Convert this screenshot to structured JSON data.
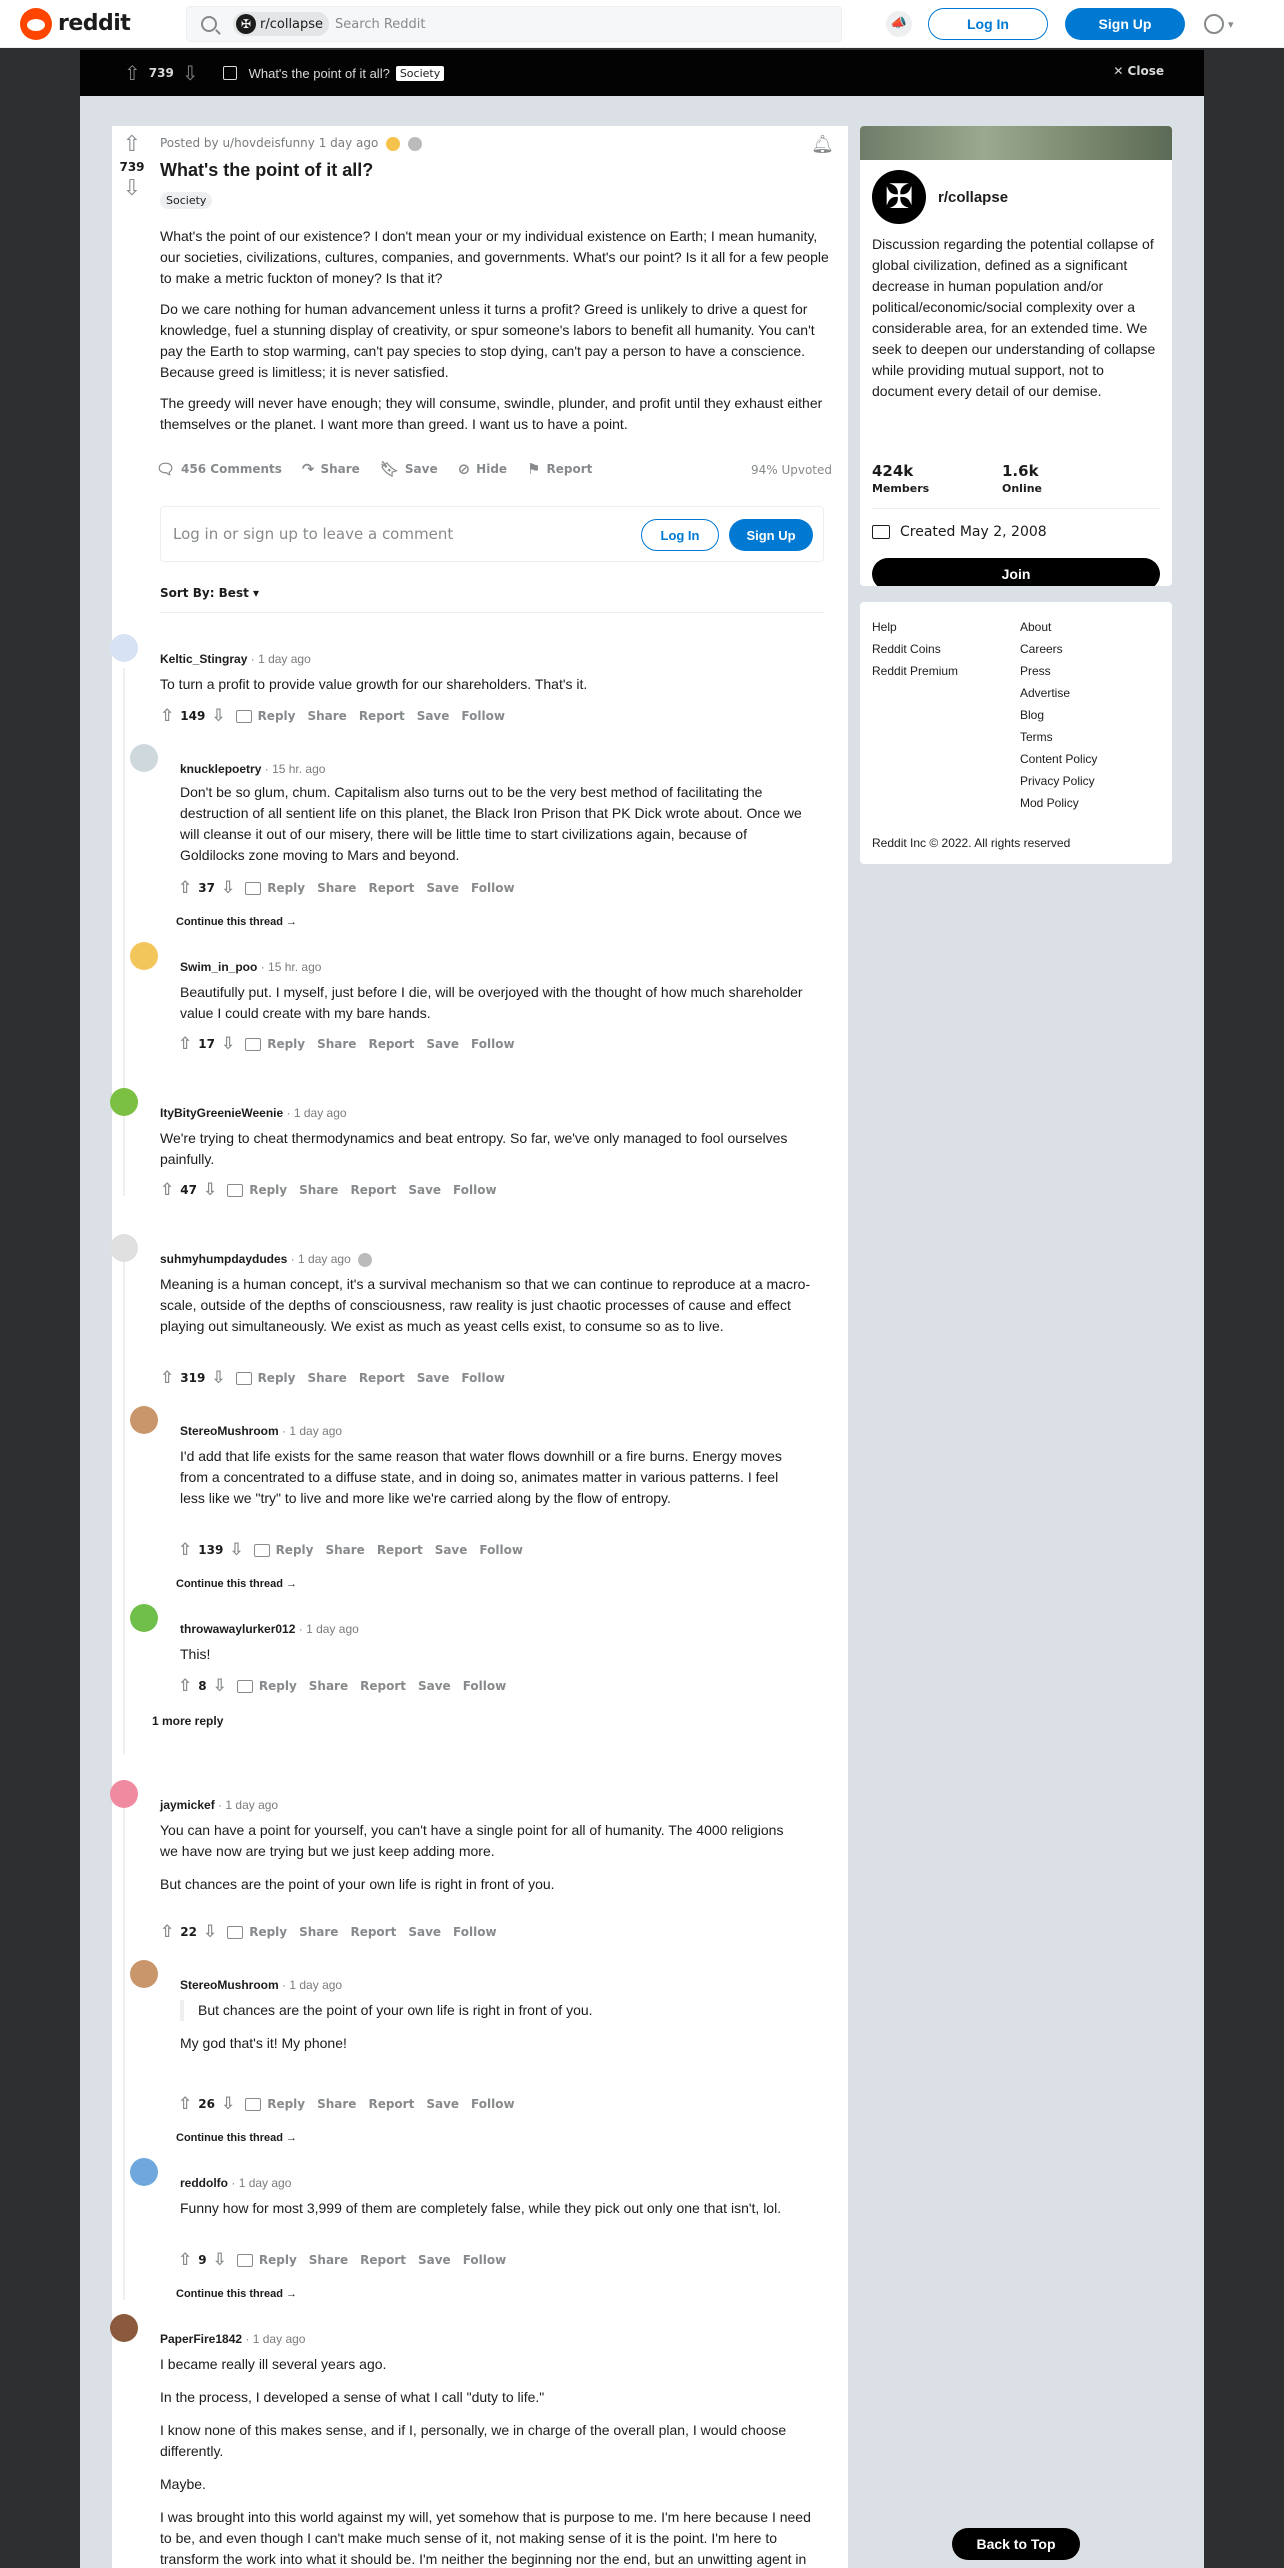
{
  "header": {
    "logo_text": "reddit",
    "subreddit_chip": "r/collapse",
    "search_placeholder": "Search Reddit",
    "login": "Log In",
    "signup": "Sign Up"
  },
  "postbar": {
    "score": "739",
    "title": "What's the point of it all?",
    "flair": "Society",
    "close": "Close"
  },
  "post": {
    "meta": "Posted by u/hovdeisfunny 1 day ago",
    "score": "739",
    "title": "What's the point of it all?",
    "flair": "Society",
    "paragraphs": [
      "What's the point of our existence? I don't mean your or my individual existence on Earth; I mean humanity, our societies, civilizations, cultures, companies, and governments. What's our point? Is it all for a few people to make a metric fuckton of money? Is that it?",
      "Do we care nothing for human advancement unless it turns a profit? Greed is unlikely to drive a quest for knowledge, fuel a stunning display of creativity, or spur someone's labors to benefit all humanity. You can't pay the Earth to stop warming, can't pay species to stop dying, can't pay a person to have a conscience. Because greed is limitless; it is never satisfied.",
      "The greedy will never have enough; they will consume, swindle, plunder, and profit until they exhaust either themselves or the planet. I want more than greed. I want us to have a point."
    ],
    "actions": {
      "comments": "456 Comments",
      "share": "Share",
      "save": "Save",
      "hide": "Hide",
      "report": "Report",
      "upvoted": "94% Upvoted"
    },
    "login_prompt": "Log in or sign up to leave a comment",
    "login_btn": "Log In",
    "signup_btn": "Sign Up",
    "sort": "Sort By: Best"
  },
  "comment_actions": {
    "reply": "Reply",
    "share": "Share",
    "report": "Report",
    "save": "Save",
    "follow": "Follow",
    "continue": "Continue this thread",
    "more_reply": "1 more reply"
  },
  "comments": [
    {
      "user": "Keltic_Stingray",
      "time": "1 day ago",
      "text": "To turn a profit to provide value growth for our shareholders. That's it.",
      "score": "149"
    },
    {
      "user": "knucklepoetry",
      "time": "15 hr. ago",
      "text": "Don't be so glum, chum. Capitalism also turns out to be the very best method of facilitating the destruction of all sentient life on this planet, the Black Iron Prison that PK Dick wrote about. Once we will cleanse it out of our misery, there will be little time to start civilizations again, because of Goldilocks zone moving to Mars and beyond.",
      "score": "37"
    },
    {
      "user": "Swim_in_poo",
      "time": "15 hr. ago",
      "text": "Beautifully put. I myself, just before I die, will be overjoyed with the thought of how much shareholder value I could create with my bare hands.",
      "score": "17"
    },
    {
      "user": "ItyBityGreenieWeenie",
      "time": "1 day ago",
      "text": "We're trying to cheat thermodynamics and beat entropy. So far, we've only managed to fool ourselves painfully.",
      "score": "47"
    },
    {
      "user": "suhmyhumpdaydudes",
      "time": "1 day ago",
      "text": "Meaning is a human concept, it's a survival mechanism so that we can continue to reproduce at a macro-scale, outside of the depths of consciousness, raw reality is just chaotic processes of cause and effect playing out simultaneously. We exist as much as yeast cells exist, to consume so as to live.",
      "score": "319"
    },
    {
      "user": "StereoMushroom",
      "time": "1 day ago",
      "text": "I'd add that life exists for the same reason that water flows downhill or a fire burns. Energy moves from a concentrated to a diffuse state, and in doing so, animates matter in various patterns. I feel less like we \"try\" to live and more like we're carried along by the flow of entropy.",
      "score": "139"
    },
    {
      "user": "throwawaylurker012",
      "time": "1 day ago",
      "text": "This!",
      "score": "8"
    },
    {
      "user": "jaymickef",
      "time": "1 day ago",
      "text": "You can have a point for yourself, you can't have a single point for all of humanity. The 4000 religions we have now are trying but we just keep adding more.",
      "text2": "But chances are the point of your own life is right in front of you.",
      "score": "22"
    },
    {
      "user": "StereoMushroom",
      "time": "1 day ago",
      "quote": "But chances are the point of your own life is right in front of you.",
      "text": "My god that's it! My phone!",
      "score": "26"
    },
    {
      "user": "reddolfo",
      "time": "1 day ago",
      "text": "Funny how for most 3,999 of them are completely false, while they pick out only one that isn't, lol.",
      "score": "9"
    },
    {
      "user": "PaperFire1842",
      "time": "1 day ago",
      "paragraphs": [
        "I became really ill several years ago.",
        "In the process, I developed a sense of what I call \"duty to life.\"",
        "I know none of this makes sense, and if I, personally, we in charge of the overall plan, I would choose differently.",
        "Maybe.",
        "I was brought into this world against my will, yet somehow that is purpose to me. I'm here because I need to be, and even though I can't make much sense of it, not making sense of it is the point. I'm here to transform the work into what it should be. I'm neither the beginning nor the end, but an unwitting agent in the process of becoming. I'm becoming. The world is"
      ]
    }
  ],
  "sidebar": {
    "name": "r/collapse",
    "description": "Discussion regarding the potential collapse of global civilization, defined as a significant decrease in human population and/or political/economic/social complexity over a considerable area, for an extended time. We seek to deepen our understanding of collapse while providing mutual support, not to document every detail of our demise.",
    "members": "424k",
    "members_label": "Members",
    "online": "1.6k",
    "online_label": "Online",
    "created": "Created May 2, 2008",
    "join": "Join"
  },
  "footer": {
    "col1": [
      "Help",
      "Reddit Coins",
      "Reddit Premium"
    ],
    "col2": [
      "About",
      "Careers",
      "Press",
      "Advertise",
      "Blog",
      "Terms",
      "Content Policy",
      "Privacy Policy",
      "Mod Policy"
    ],
    "copyright": "Reddit Inc © 2022. All rights reserved"
  },
  "back_to_top": "Back to Top",
  "colors": {
    "brand": "#ff4500",
    "blue": "#0079d3"
  }
}
